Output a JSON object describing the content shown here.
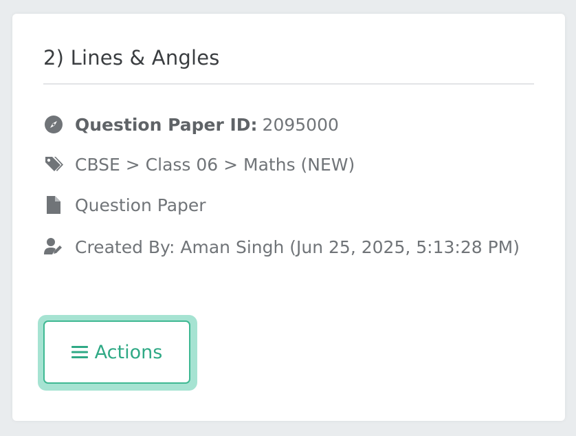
{
  "card": {
    "title": "2) Lines & Angles",
    "id_label": "Question Paper ID:",
    "id_value": "2095000",
    "breadcrumb": "CBSE > Class 06 > Maths (NEW)",
    "type": "Question Paper",
    "created_by": "Created By: Aman Singh (Jun 25, 2025, 5:13:28 PM)",
    "actions_label": "Actions"
  },
  "icons": {
    "id": "compass-icon",
    "breadcrumb": "tags-icon",
    "type": "file-icon",
    "created_by": "user-edit-icon",
    "actions": "bars-icon"
  },
  "colors": {
    "accent": "#3eb892",
    "accent_focus_ring": "#a6e3d2",
    "text_title": "#3a3d40",
    "text_body": "#707478"
  }
}
